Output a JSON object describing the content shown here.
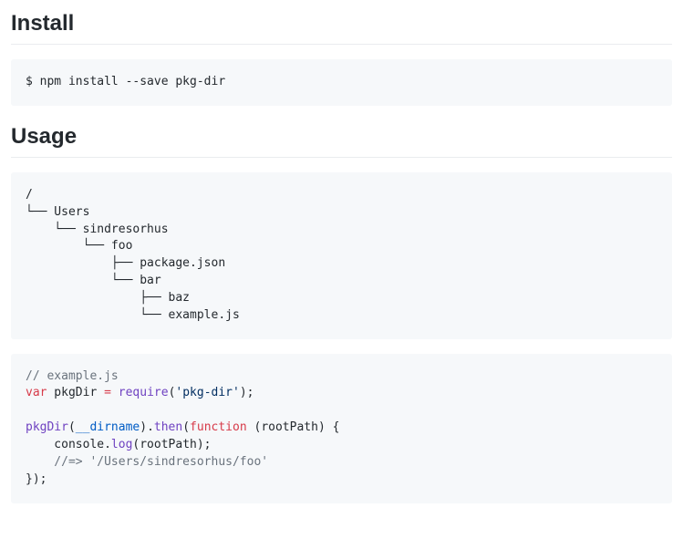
{
  "install": {
    "heading": "Install",
    "command": "$ npm install --save pkg-dir"
  },
  "usage": {
    "heading": "Usage",
    "tree": "/\n└── Users\n    └── sindresorhus\n        └── foo\n            ├── package.json\n            └── bar\n                ├── baz\n                └── example.js",
    "code": {
      "c1": "// example.js",
      "k_var": "var",
      "v_pkgDir": " pkgDir ",
      "k_eq": "=",
      "sp1": " ",
      "f_require": "require",
      "p_open1": "(",
      "s_mod": "'pkg-dir'",
      "p_close1": ");",
      "blank": "",
      "f_pkgDir": "pkgDir",
      "p_open2": "(",
      "b_dirname": "__dirname",
      "p_close2": ").",
      "f_then": "then",
      "p_open3": "(",
      "k_function": "function",
      "v_args": " (",
      "v_rootPath": "rootPath",
      "v_argsEnd": ") {",
      "line_log_indent": "    console.",
      "f_log": "log",
      "p_open4": "(rootPath);",
      "c2": "    //=> '/Users/sindresorhus/foo'",
      "line_end": "});"
    }
  }
}
